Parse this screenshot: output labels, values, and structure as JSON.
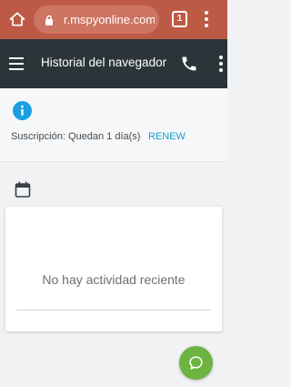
{
  "browser": {
    "url": "r.mspyonline.com",
    "tab_count": "1"
  },
  "app_bar": {
    "title": "Historial del navegador"
  },
  "subscription": {
    "text": "Suscripción: Quedan 1 día(s)",
    "renew_label": "RENEW"
  },
  "activity": {
    "empty_message": "No hay actividad reciente"
  },
  "icons": {
    "browser_home": "home-icon",
    "lock": "lock-icon",
    "browser_menu": "more-vert-icon",
    "menu": "hamburger-icon",
    "phone": "phone-icon",
    "app_menu": "more-vert-icon",
    "info": "info-icon",
    "calendar": "calendar-icon",
    "chat": "chat-icon"
  },
  "colors": {
    "browser_bar": "#bd5a45",
    "app_bar": "#2b3439",
    "info_blue": "#1a9fe0",
    "renew_link": "#1a9ccf",
    "chat_green": "#6cb43f"
  }
}
